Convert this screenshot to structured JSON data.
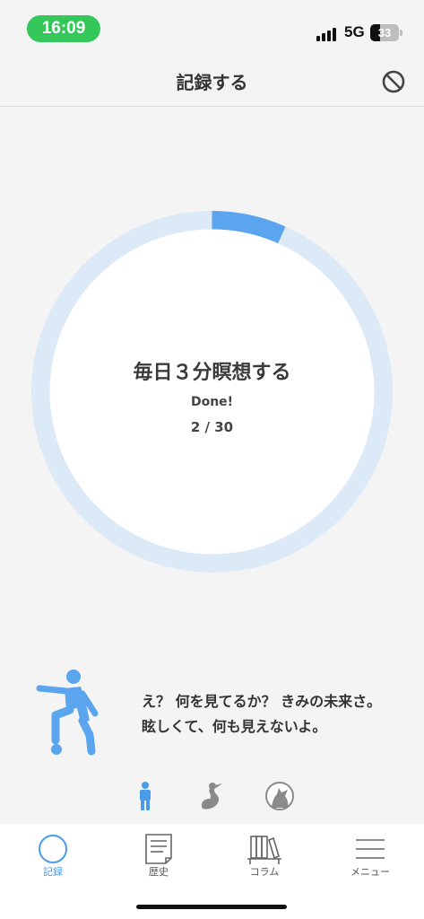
{
  "status_bar": {
    "time": "16:09",
    "network": "5G",
    "battery": "33",
    "battery_level": 0.33
  },
  "header": {
    "title": "記録する",
    "right_icon": "block-icon"
  },
  "habit": {
    "title": "毎日３分瞑想する",
    "status": "Done!",
    "progress_text": "2 / 30",
    "completed": 2,
    "total": 30,
    "progress_fraction": 0.0667,
    "colors": {
      "track": "#dce9f6",
      "fill": "#5aa5ee",
      "inner": "#ffffff"
    }
  },
  "character": {
    "icon": "soccer-player-icon",
    "message_line1": "え？ 何を見てるか？ きみの未来さ。",
    "message_line2": "眩しくて、何も見えないよ。"
  },
  "character_selector": [
    {
      "icon": "person-icon",
      "selected": true
    },
    {
      "icon": "bird-icon",
      "selected": false
    },
    {
      "icon": "wolf-icon",
      "selected": false
    }
  ],
  "tabs": [
    {
      "label": "記録",
      "icon": "circle-icon",
      "active": true
    },
    {
      "label": "歴史",
      "icon": "document-icon",
      "active": false
    },
    {
      "label": "コラム",
      "icon": "bookshelf-icon",
      "active": false
    },
    {
      "label": "メニュー",
      "icon": "menu-icon",
      "active": false
    }
  ],
  "accent_color": "#4a9be8"
}
